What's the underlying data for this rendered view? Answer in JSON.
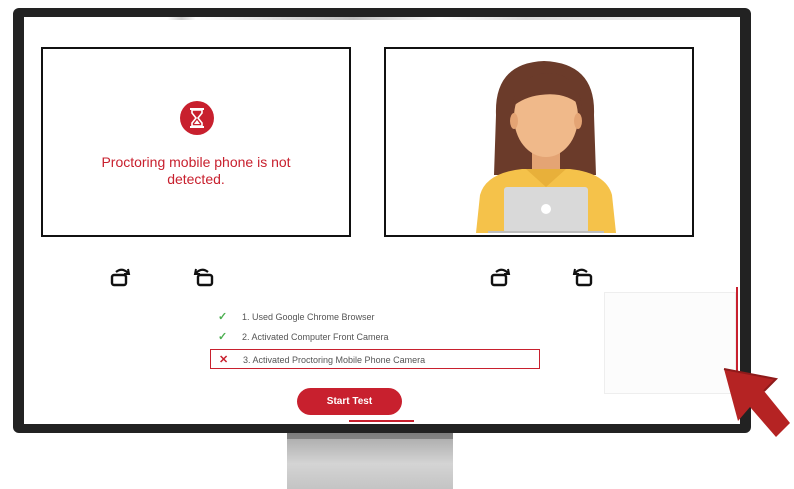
{
  "camera_panel": {
    "status_message": "Proctoring mobile phone is not detected."
  },
  "checklist": [
    {
      "status": "ok",
      "text": "1. Used Google Chrome Browser"
    },
    {
      "status": "ok",
      "text": "2. Activated Computer Front Camera"
    },
    {
      "status": "fail",
      "text": "3. Activated Proctoring Mobile Phone Camera"
    }
  ],
  "check_symbols": {
    "ok": "✓",
    "fail": "✕"
  },
  "start_button": {
    "label": "Start Test"
  },
  "icons": [
    "hourglass-icon",
    "rotate-left-icon",
    "rotate-right-icon",
    "avatar-illustration",
    "cursor-arrow-icon"
  ],
  "colors": {
    "accent": "#c8202e",
    "success": "#4caf50",
    "bezel": "#222222",
    "avatar_hair": "#6b3b2a",
    "avatar_skin": "#f0b98a",
    "avatar_shirt": "#f5c24a",
    "laptop": "#d9d9d9"
  }
}
